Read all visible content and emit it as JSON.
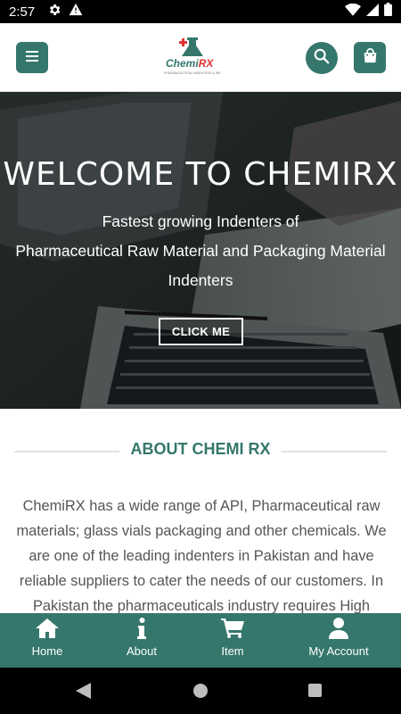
{
  "status_bar": {
    "time": "2:57"
  },
  "header": {
    "logo": {
      "text_main": "Chemi",
      "text_accent": "RX",
      "tagline": "PHARMACEUTICAL INDENTERS & IMPORTERS"
    },
    "icons": [
      "menu-icon",
      "search-icon",
      "shopping-bag-icon"
    ]
  },
  "hero": {
    "title": "WELCOME TO CHEMIRX",
    "subtitle_lines": [
      "Fastest growing Indenters of",
      "Pharmaceutical Raw Material and Packaging Material",
      "Indenters"
    ],
    "button_label": "CLICK ME"
  },
  "about": {
    "title": "ABOUT CHEMI RX",
    "text": "ChemiRX has a wide range of API, Pharmaceutical raw materials; glass vials packaging and other chemicals. We are one of the leading indenters in Pakistan and have reliable suppliers to cater the needs of our customers. In Pakistan the pharmaceuticals industry requires High"
  },
  "bottom_nav": {
    "items": [
      {
        "label": "Home",
        "icon": "home-icon"
      },
      {
        "label": "About",
        "icon": "info-icon"
      },
      {
        "label": "Item",
        "icon": "cart-icon"
      },
      {
        "label": "My Account",
        "icon": "user-icon"
      }
    ]
  },
  "colors": {
    "brand": "#35776c",
    "brand_accent": "#d33333",
    "text_body": "#555555"
  }
}
